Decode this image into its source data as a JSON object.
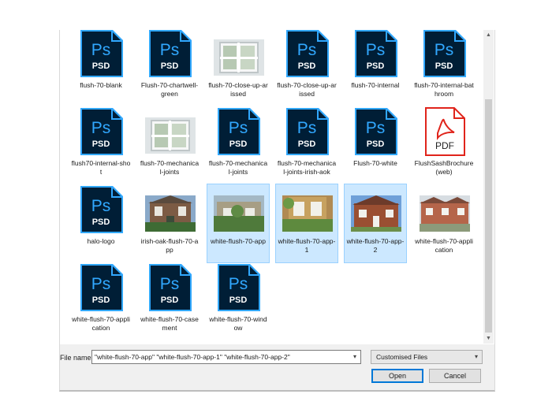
{
  "files": [
    {
      "name": "flush-70-blank",
      "type": "psd",
      "selected": false
    },
    {
      "name": "Flush-70-chartwell-green",
      "type": "psd",
      "selected": false
    },
    {
      "name": "flush-70-close-up-arissed",
      "type": "photo-window",
      "selected": false
    },
    {
      "name": "flush-70-close-up-arissed",
      "type": "psd",
      "selected": false
    },
    {
      "name": "flush-70-internal",
      "type": "psd",
      "selected": false
    },
    {
      "name": "flush-70-internal-bathroom",
      "type": "psd",
      "selected": false
    },
    {
      "name": "flush70-internal-shot",
      "type": "psd",
      "selected": false
    },
    {
      "name": "flush-70-mechanical-joints",
      "type": "photo-window",
      "selected": false
    },
    {
      "name": "flush-70-mechanical-joints",
      "type": "psd",
      "selected": false
    },
    {
      "name": "flush-70-mechanical-joints-irish-aok",
      "type": "psd",
      "selected": false
    },
    {
      "name": "Flush-70-white",
      "type": "psd",
      "selected": false
    },
    {
      "name": "FlushSashBrochure(web)",
      "type": "pdf",
      "selected": false
    },
    {
      "name": "halo-logo",
      "type": "psd",
      "selected": false
    },
    {
      "name": "irish-oak-flush-70-app",
      "type": "photo-house",
      "selected": false
    },
    {
      "name": "white-flush-70-app",
      "type": "photo-cottage",
      "selected": true
    },
    {
      "name": "white-flush-70-app-1",
      "type": "photo-door",
      "selected": true
    },
    {
      "name": "white-flush-70-app-2",
      "type": "photo-brick",
      "selected": true
    },
    {
      "name": "white-flush-70-application",
      "type": "photo-street",
      "selected": false
    },
    {
      "name": "white-flush-70-application",
      "type": "psd",
      "selected": false
    },
    {
      "name": "white-flush-70-casement",
      "type": "psd",
      "selected": false
    },
    {
      "name": "white-flush-70-window",
      "type": "psd",
      "selected": false
    }
  ],
  "icons": {
    "psd": {
      "text_top": "Ps",
      "text_bottom": "PSD",
      "bg": "#001e36",
      "accent": "#31a8ff"
    },
    "pdf": {
      "text": "PDF",
      "accent": "#e0241b"
    }
  },
  "footer": {
    "file_name_label": "File name:",
    "file_name_value": "\"white-flush-70-app\" \"white-flush-70-app-1\" \"white-flush-70-app-2\"",
    "file_type_value": "Customised Files",
    "open_label": "Open",
    "cancel_label": "Cancel"
  }
}
